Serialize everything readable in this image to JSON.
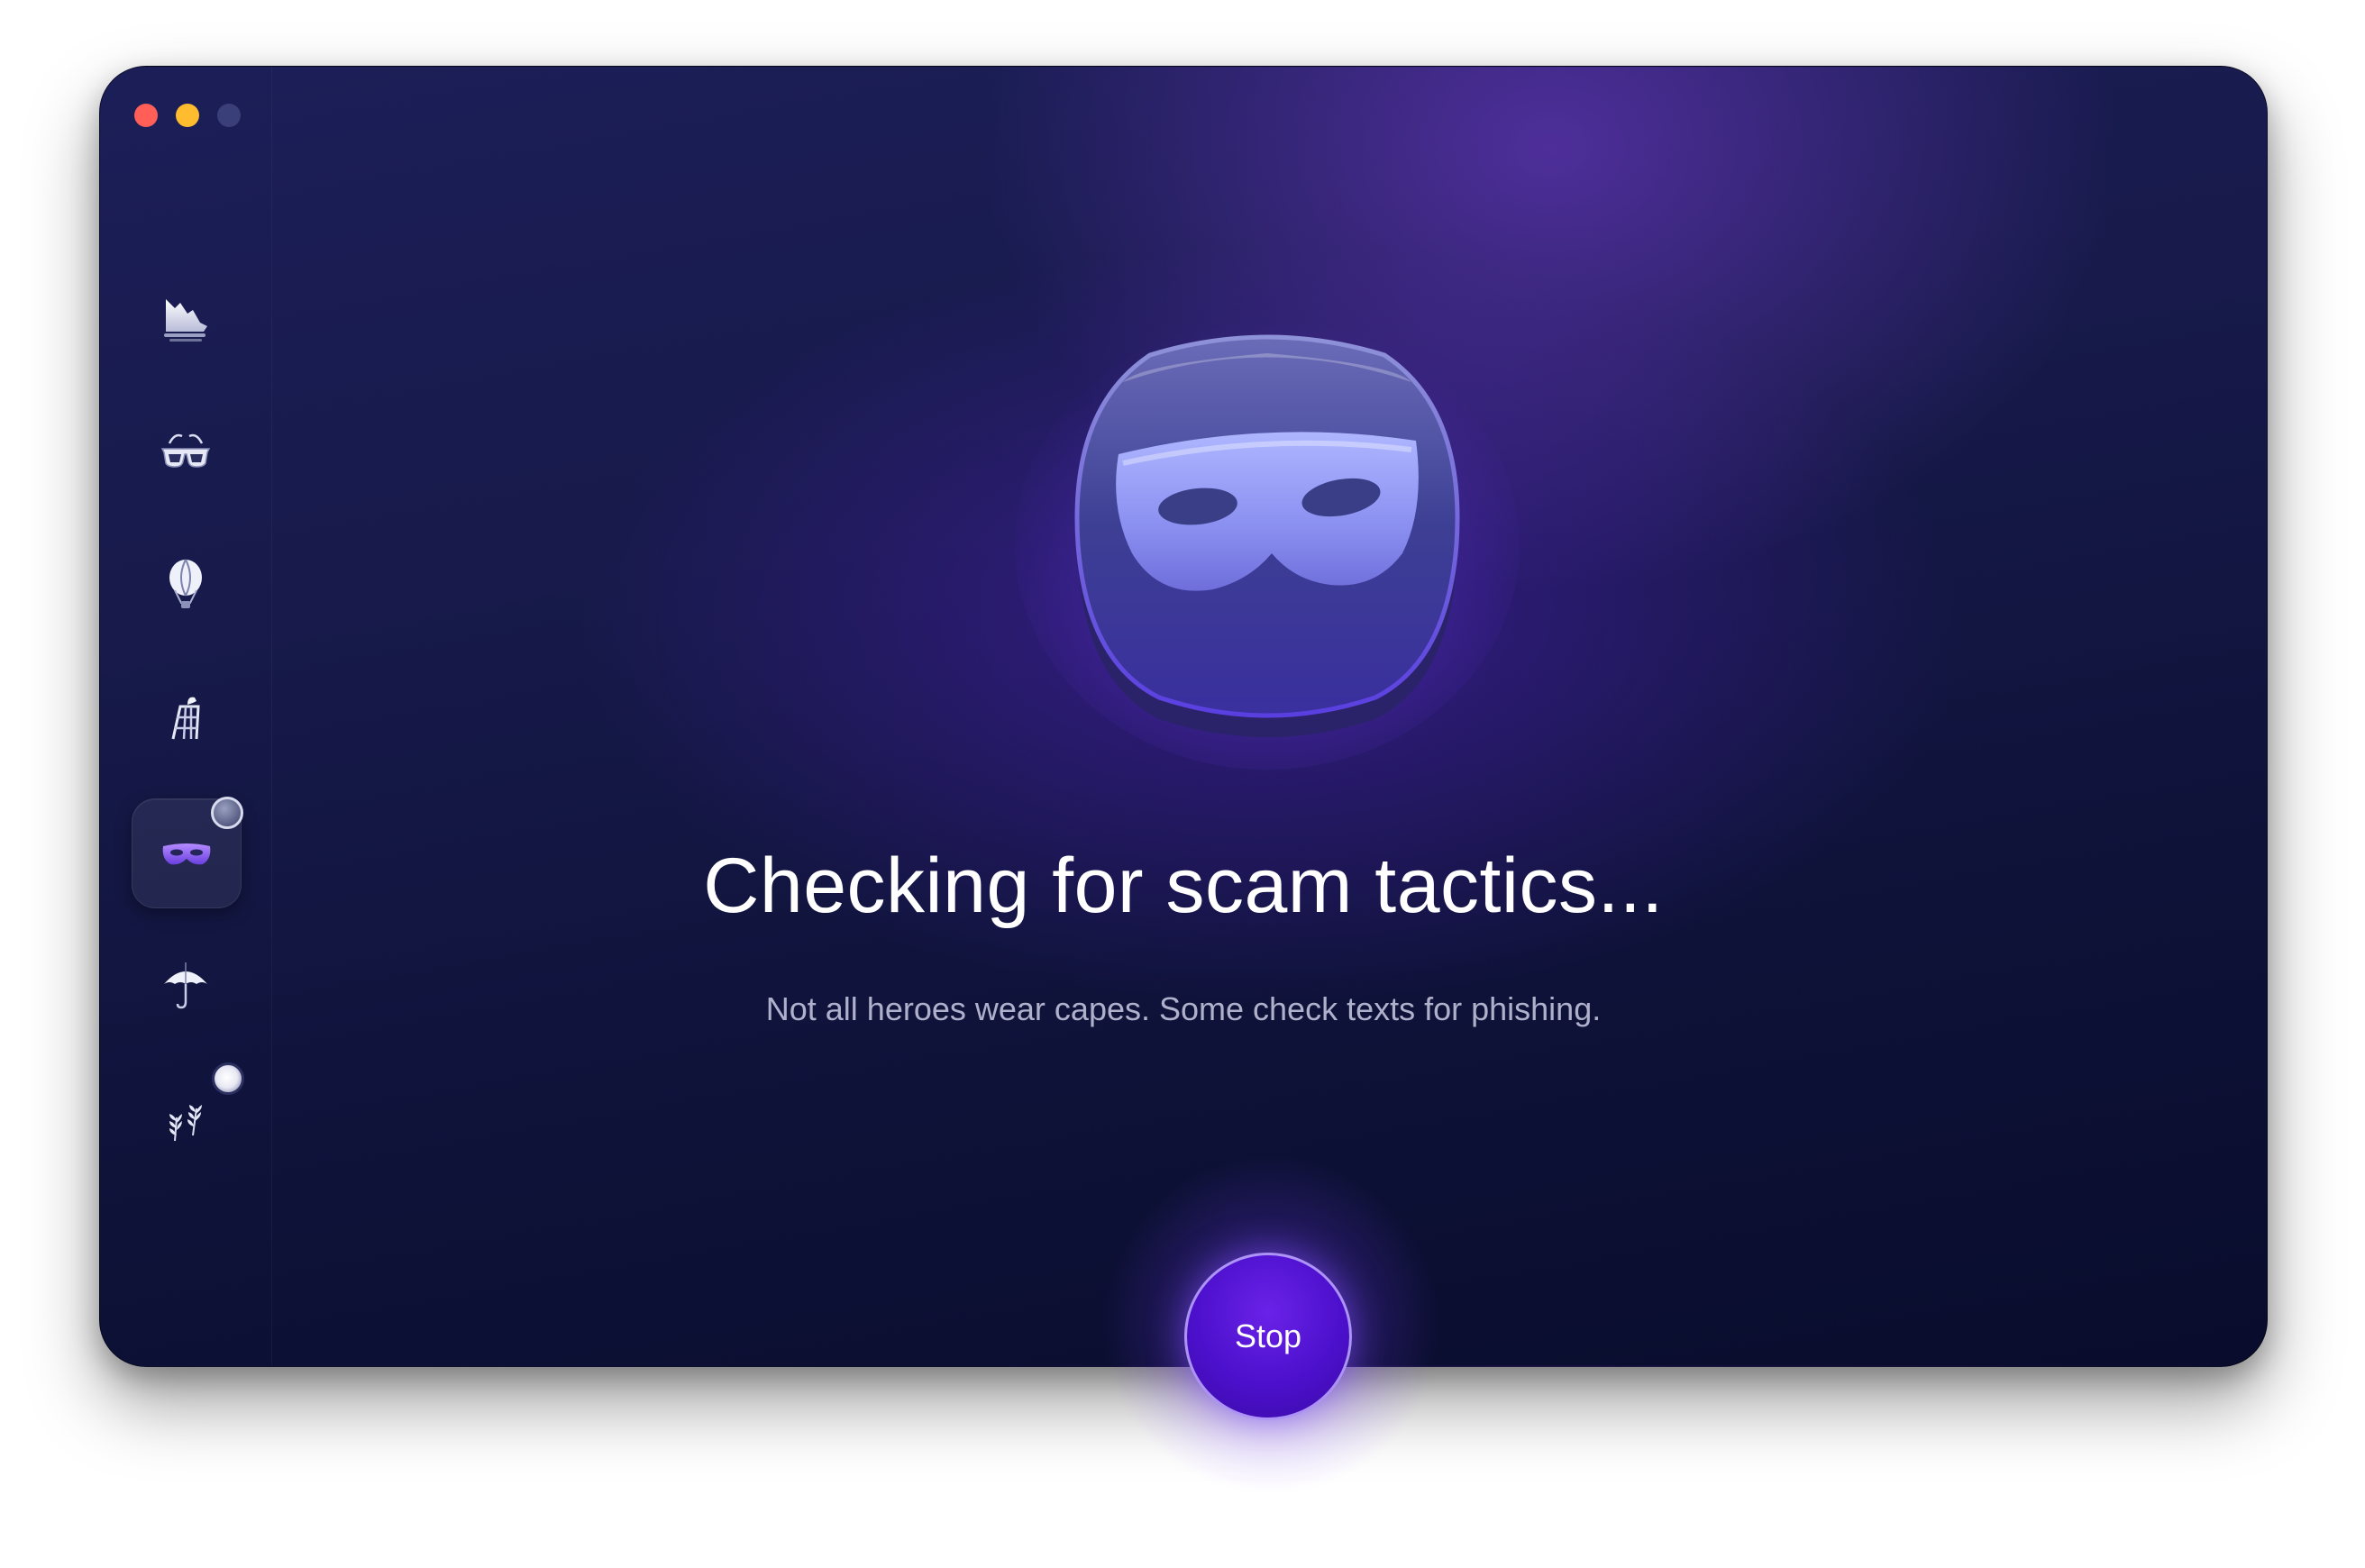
{
  "window": {
    "traffic_lights": [
      "close",
      "minimize",
      "zoom"
    ]
  },
  "sidebar": {
    "items": [
      {
        "id": "cleanup",
        "icon": "ship-icon",
        "active": false
      },
      {
        "id": "protection",
        "icon": "glasses-icon",
        "active": false
      },
      {
        "id": "performance",
        "icon": "balloon-icon",
        "active": false
      },
      {
        "id": "applications",
        "icon": "scaffold-icon",
        "active": false
      },
      {
        "id": "scam-check",
        "icon": "mask-icon",
        "active": true
      },
      {
        "id": "privacy",
        "icon": "umbrella-icon",
        "active": false
      },
      {
        "id": "clutter",
        "icon": "leaves-icon",
        "active": false
      }
    ]
  },
  "main": {
    "hero_icon": "mask-icon",
    "title": "Checking for scam tactics...",
    "subtitle": "Not all heroes wear capes. Some check texts for phishing.",
    "stop_label": "Stop"
  },
  "colors": {
    "accent": "#5a18e0",
    "close": "#ff5f57",
    "minimize": "#febc2e"
  }
}
